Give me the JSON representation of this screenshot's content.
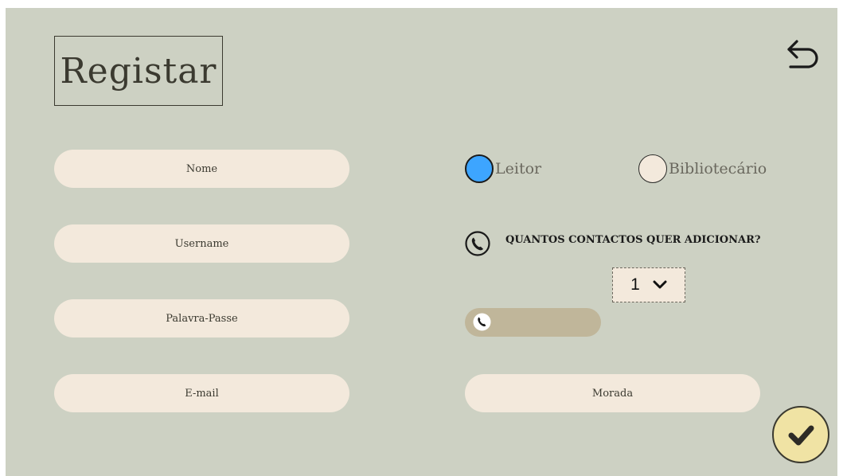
{
  "page": {
    "title": "Registar"
  },
  "fields": {
    "nome": {
      "placeholder": "Nome"
    },
    "username": {
      "placeholder": "Username"
    },
    "password": {
      "placeholder": "Palavra-Passe"
    },
    "email": {
      "placeholder": "E-mail"
    },
    "morada": {
      "placeholder": "Morada"
    }
  },
  "role": {
    "options": [
      {
        "label": "Leitor",
        "selected": true
      },
      {
        "label": "Bibliotecário",
        "selected": false
      }
    ]
  },
  "contacts": {
    "question": "QUANTOS CONTACTOS QUER ADICIONAR?",
    "count_selected": "1"
  },
  "colors": {
    "background": "#cdd1c3",
    "field": "#f3e9dc",
    "contact_field": "#c0b69a",
    "radio_selected": "#3da5ff",
    "confirm": "#f0e3a4",
    "text": "#3b3a30"
  },
  "icons": {
    "back": "undo-arrow-icon",
    "phone": "phone-icon",
    "confirm": "checkmark-icon",
    "select_arrow": "chevron-down-icon"
  }
}
